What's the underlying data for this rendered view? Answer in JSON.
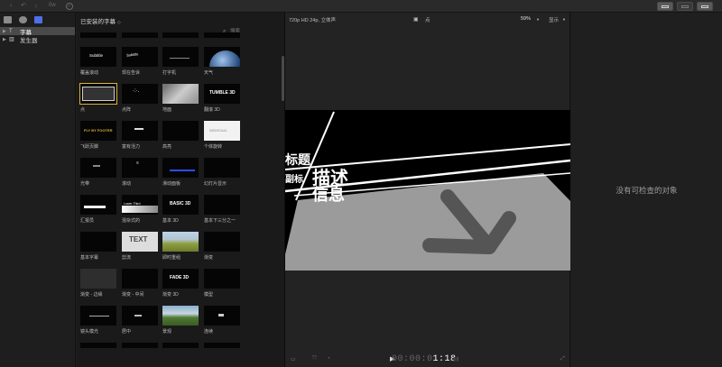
{
  "toolbar": {
    "undo_icon": "undo-arrow-icon",
    "import_icon": "import-down-arrow-icon",
    "keyword_text": "0w",
    "check_icon": "check-circle-icon",
    "layout_buttons": [
      "library-layout",
      "timeline-layout",
      "inspector-layout"
    ]
  },
  "sidebar": {
    "items": [
      {
        "label": "字幕",
        "icon": "T",
        "selected": true
      },
      {
        "label": "发生器",
        "icon": "▥",
        "selected": false
      }
    ]
  },
  "browser": {
    "title": "已安装的字幕",
    "title_chevron": "◇",
    "search_placeholder": "搜索",
    "tiles": [
      {
        "label": "",
        "cut": true
      },
      {
        "label": "",
        "cut": true
      },
      {
        "label": "",
        "cut": true
      },
      {
        "label": "",
        "cut": true
      },
      {
        "label": "覆盖滚动"
      },
      {
        "label": "现在告诉"
      },
      {
        "label": "打字机"
      },
      {
        "label": "天气"
      },
      {
        "label": "点",
        "selected": true
      },
      {
        "label": "点阵"
      },
      {
        "label": "地面"
      },
      {
        "label": "翻滚 3D"
      },
      {
        "label": "飞跃页脚"
      },
      {
        "label": "富有活力"
      },
      {
        "label": "高亮"
      },
      {
        "label": "个体旋转"
      },
      {
        "label": "光带"
      },
      {
        "label": "滚动"
      },
      {
        "label": "滑动面板"
      },
      {
        "label": "幻灯片显示"
      },
      {
        "label": "汇报员"
      },
      {
        "label": "混杂式的"
      },
      {
        "label": "基本 3D"
      },
      {
        "label": "基本下三分之一"
      },
      {
        "label": "基本字幕"
      },
      {
        "label": "剪流"
      },
      {
        "label": "即时重组"
      },
      {
        "label": "渐变"
      },
      {
        "label": "渐变 - 边缘"
      },
      {
        "label": "渐变 - 中间"
      },
      {
        "label": "渐变 3D"
      },
      {
        "label": "模型"
      },
      {
        "label": "镜头模光"
      },
      {
        "label": "居中"
      },
      {
        "label": "景观"
      },
      {
        "label": "连续"
      },
      {
        "label": "",
        "cut": true
      },
      {
        "label": "",
        "cut": true
      },
      {
        "label": "",
        "cut": true
      },
      {
        "label": "",
        "cut": true
      }
    ],
    "thumb_texts": {
      "overlay": "Subtitle",
      "typewriter_line": "—————",
      "tumble": "TUMBLE 3D",
      "flyby": "FLY BY FOOTER",
      "rotate": "INDIVIDUAL",
      "scroll_lines": "≡",
      "lower_third": "Lower Third",
      "basic3d": "BASIC 3D",
      "fade3d": "FADE 3D",
      "text_icon": "TEXT"
    }
  },
  "viewer": {
    "format": "720p HD 24p, 立体声",
    "clip_name": "点",
    "zoom": "59%",
    "display_menu": "显示",
    "canvas_text": {
      "line1": "描述",
      "line2": "信息",
      "side_a": "标题",
      "side_b": "副标"
    },
    "timecode": {
      "dim": "00:00:0",
      "bright": "1:18"
    }
  },
  "inspector": {
    "message": "没有可检查的对象"
  },
  "colors": {
    "selection": "#d9b43a",
    "background": "#1e1e1e",
    "canvas_gray": "#9b9b9b"
  }
}
